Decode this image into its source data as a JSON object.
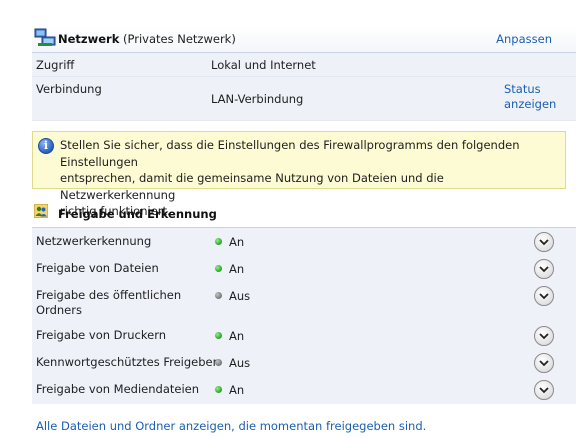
{
  "network": {
    "name": "Netzwerk",
    "type": "(Privates Netzwerk)",
    "customize_link": "Anpassen",
    "icon": "network-icon"
  },
  "info_rows": {
    "access_label": "Zugriff",
    "access_value": "Lokal und Internet",
    "connection_label": "Verbindung",
    "connection_value": "LAN-Verbindung",
    "status_link_line1": "Status",
    "status_link_line2": "anzeigen"
  },
  "warning": {
    "icon": "info-icon",
    "icon_glyph": "i",
    "line1": "Stellen Sie sicher, dass die Einstellungen des Firewallprogramms den folgenden Einstellungen",
    "line2": "entsprechen, damit die gemeinsame Nutzung von Dateien und die Netzwerkerkennung",
    "line3": "richtig funktioniert."
  },
  "sharing": {
    "title": "Freigabe und Erkennung",
    "icon": "sharing-users-icon",
    "items": [
      {
        "label_line1": "Netzwerkerkennung",
        "label_line2": "",
        "state": "An",
        "on": true
      },
      {
        "label_line1": "Freigabe von Dateien",
        "label_line2": "",
        "state": "An",
        "on": true
      },
      {
        "label_line1": "Freigabe des öffentlichen",
        "label_line2": "Ordners",
        "state": "Aus",
        "on": false
      },
      {
        "label_line1": "Freigabe von Druckern",
        "label_line2": "",
        "state": "An",
        "on": true
      },
      {
        "label_line1": "Kennwortgeschütztes Freigeben",
        "label_line2": "",
        "state": "Aus",
        "on": false
      },
      {
        "label_line1": "Freigabe von Mediendateien",
        "label_line2": "",
        "state": "An",
        "on": true
      }
    ]
  },
  "bottom_link": "Alle Dateien und Ordner anzeigen, die momentan freigegeben sind.",
  "colors": {
    "link": "#1a5fb4",
    "on_dot": "#1f9b1a",
    "off_dot": "#6e6e6e",
    "warning_bg": "#fdfbd3"
  }
}
